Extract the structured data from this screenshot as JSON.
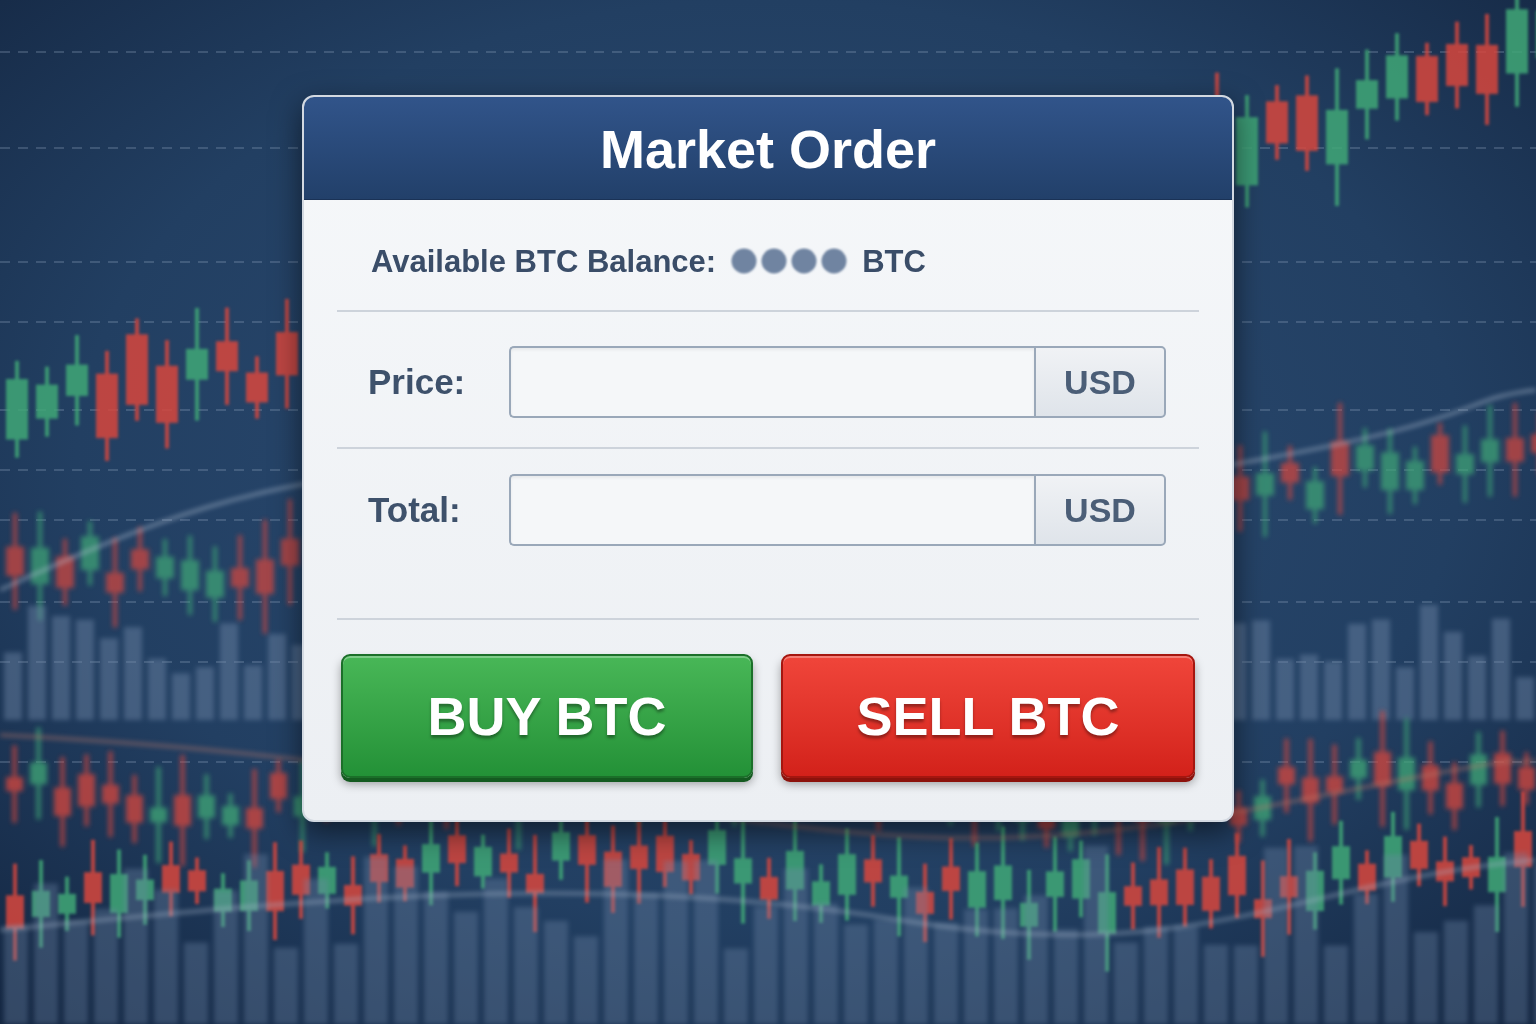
{
  "dialog": {
    "title": "Market Order"
  },
  "balance": {
    "label": "Available BTC Balance:",
    "masked": true,
    "unit": "BTC"
  },
  "fields": [
    {
      "label": "Price:",
      "unit": "USD"
    },
    {
      "label": "Total:",
      "unit": "USD"
    }
  ],
  "buttons": [
    {
      "label": "BUY BTC",
      "kind": "buy"
    },
    {
      "label": "SELL BTC",
      "kind": "sell"
    }
  ]
}
